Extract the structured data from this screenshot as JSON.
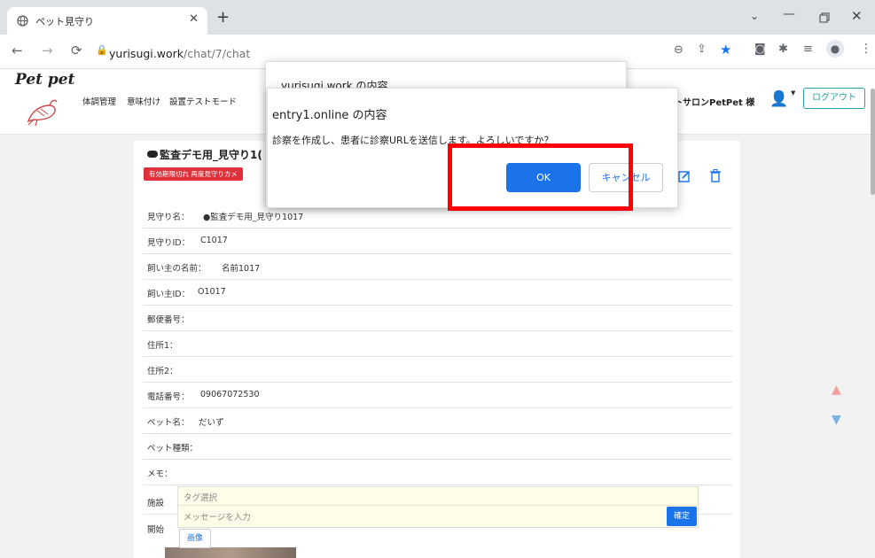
{
  "browser": {
    "tab_title": "ペット見守り",
    "url_host": "yurisugi.work",
    "url_path": "/chat/7/chat"
  },
  "app": {
    "logo": "Pet pet",
    "nav": [
      "体調管理",
      "意味付け",
      "設置テストモード"
    ],
    "user": "トサロンPetPet 様",
    "logout": "ログアウト"
  },
  "card": {
    "title": "監査デモ用_見守り1(",
    "badge": "有効期限切れ 再度見守りカメ"
  },
  "fields": [
    {
      "label": "見守り名：",
      "value": "●監査デモ用_見守り1017"
    },
    {
      "label": "見守りID：",
      "value": "C1017"
    },
    {
      "label": "飼い主の名前：",
      "value": "名前1017"
    },
    {
      "label": "飼い主ID：",
      "value": "O1017"
    },
    {
      "label": "郵便番号：",
      "value": ""
    },
    {
      "label": "住所1：",
      "value": ""
    },
    {
      "label": "住所2：",
      "value": ""
    },
    {
      "label": "電話番号：",
      "value": "09067072530"
    },
    {
      "label": "ペット名：",
      "value": "だいず"
    },
    {
      "label": "ペット種類：",
      "value": ""
    },
    {
      "label": "メモ：",
      "value": ""
    },
    {
      "label": "施設",
      "value": ""
    },
    {
      "label": "開始",
      "value": ""
    }
  ],
  "back_dialog": {
    "title": "yurisugi.work の内容"
  },
  "dialog": {
    "title": "entry1.online の内容",
    "message": "診察を作成し、患者に診察URLを送信します。よろしいですか？",
    "ok": "OK",
    "cancel": "キャンセル"
  },
  "chat": {
    "tag_placeholder": "タグ選択",
    "message_placeholder": "メッセージを入力",
    "confirm": "確定",
    "image": "画像"
  },
  "colors": {
    "accent": "#1a73e8",
    "highlight": "#ff0000",
    "badge": "#e0303a",
    "teal": "#2aa1a5"
  }
}
